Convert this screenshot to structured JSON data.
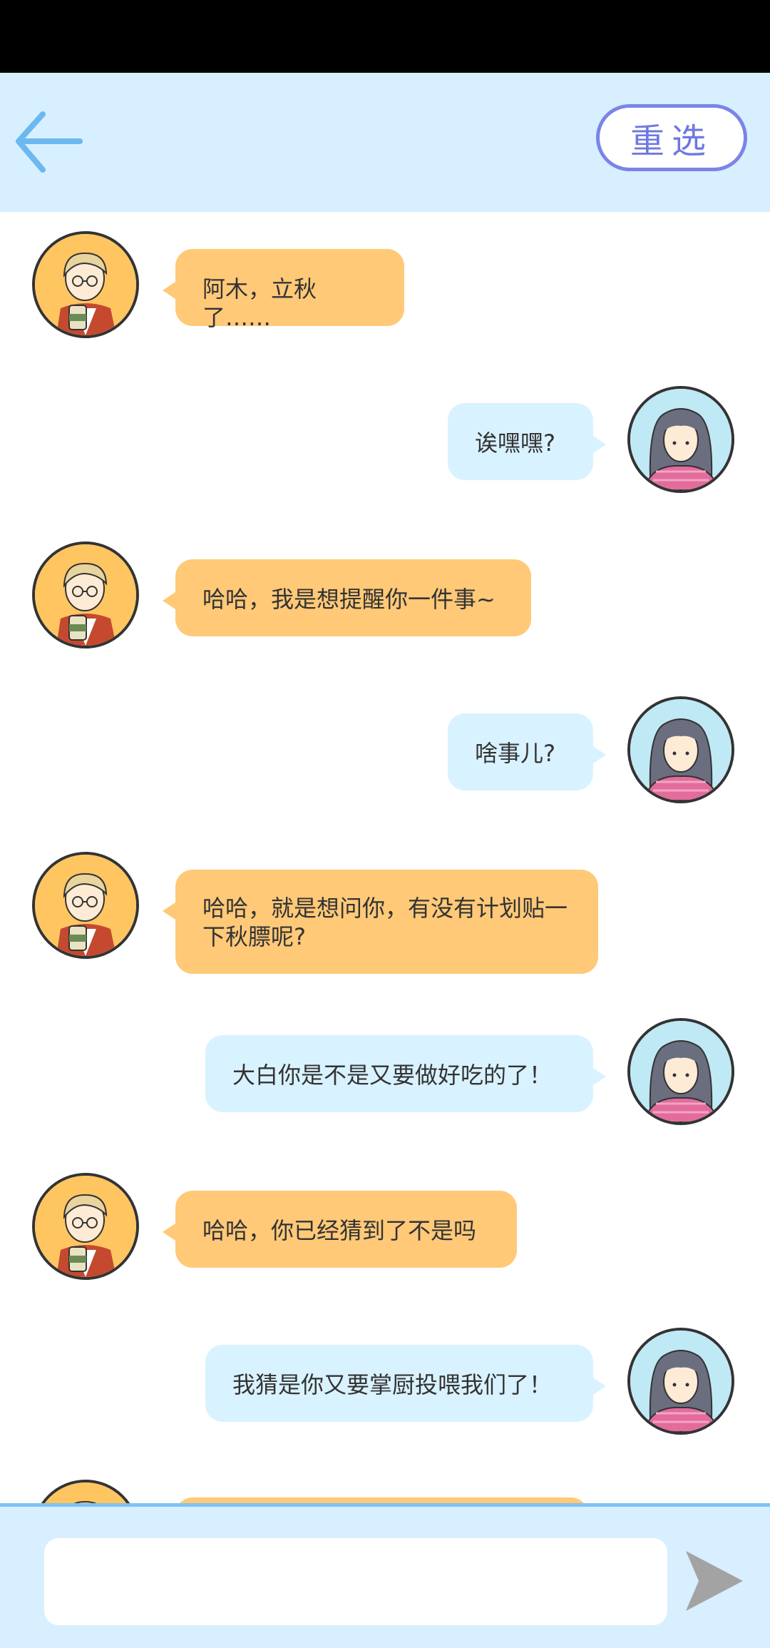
{
  "header": {
    "back_icon": "arrow-left-icon",
    "reset_label": "重选",
    "accent_color": "#7b84e6"
  },
  "messages": [
    {
      "side": "left",
      "text": "阿木，立秋了……"
    },
    {
      "side": "right",
      "text": "诶嘿嘿?"
    },
    {
      "side": "left",
      "text": "哈哈，我是想提醒你一件事~"
    },
    {
      "side": "right",
      "text": "啥事儿?"
    },
    {
      "side": "left",
      "text": "哈哈，就是想问你，有没有计划贴一下秋膘呢?"
    },
    {
      "side": "right",
      "text": "大白你是不是又要做好吃的了！"
    },
    {
      "side": "left",
      "text": "哈哈，你已经猜到了不是吗"
    },
    {
      "side": "right",
      "text": "我猜是你又要掌厨投喂我们了！"
    },
    {
      "side": "left",
      "text": ""
    }
  ],
  "footer": {
    "input_value": "",
    "send_icon": "send-arrow-icon"
  },
  "colors": {
    "left_bubble": "#ffc978",
    "right_bubble": "#d9f2ff",
    "header_bg": "#d7efff"
  }
}
